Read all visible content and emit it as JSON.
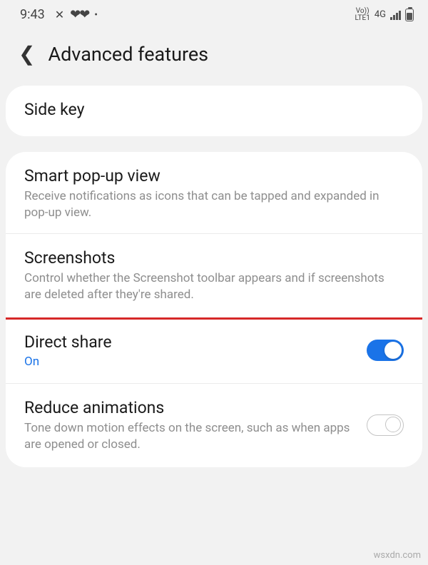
{
  "status": {
    "time": "9:43",
    "net_top": "Vo))",
    "net_bottom": "LTE1",
    "net_gen": "4G"
  },
  "header": {
    "title": "Advanced features"
  },
  "card1": {
    "side_key": "Side key"
  },
  "card2": {
    "popup": {
      "title": "Smart pop-up view",
      "desc": "Receive notifications as icons that can be tapped and expanded in pop-up view."
    },
    "screenshots": {
      "title": "Screenshots",
      "desc": "Control whether the Screenshot toolbar appears and if screenshots are deleted after they're shared."
    },
    "direct_share": {
      "title": "Direct share",
      "state": "On"
    },
    "reduce": {
      "title": "Reduce animations",
      "desc": "Tone down motion effects on the screen, such as when apps are opened or closed."
    }
  },
  "watermark": "wsxdn.com"
}
